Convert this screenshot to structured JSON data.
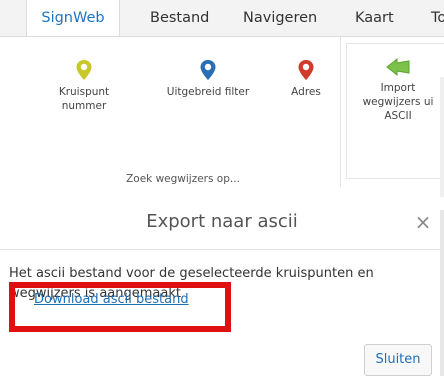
{
  "tabs": [
    {
      "label": "SignWeb",
      "active": true
    },
    {
      "label": "Bestand",
      "active": false
    },
    {
      "label": "Navigeren",
      "active": false
    },
    {
      "label": "Kaart",
      "active": false
    },
    {
      "label": "To",
      "active": false
    }
  ],
  "ribbon": {
    "group_caption": "Zoek wegwijzers op...",
    "buttons": [
      {
        "label_line1": "Kruispunt",
        "label_line2": "nummer",
        "icon": "map-pin-icon",
        "color": "#c8c82a"
      },
      {
        "label_line1": "Uitgebreid filter",
        "label_line2": "",
        "icon": "map-pin-icon",
        "color": "#2a6fb5"
      },
      {
        "label_line1": "Adres",
        "label_line2": "",
        "icon": "map-pin-icon",
        "color": "#d03a2a"
      }
    ],
    "import": {
      "label_line1": "Import",
      "label_line2": "wegwijzers ui",
      "label_line3": "ASCII",
      "icon": "arrow-left-icon",
      "color": "#7cc24a"
    }
  },
  "dialog": {
    "title": "Export naar ascii",
    "close_symbol": "×",
    "message": "Het ascii bestand voor de geselecteerde kruispunten en wegwijzers is aangemaakt",
    "download_link": "Download ascii bestand",
    "close_button": "Sluiten",
    "highlight_color": "#e01010"
  }
}
